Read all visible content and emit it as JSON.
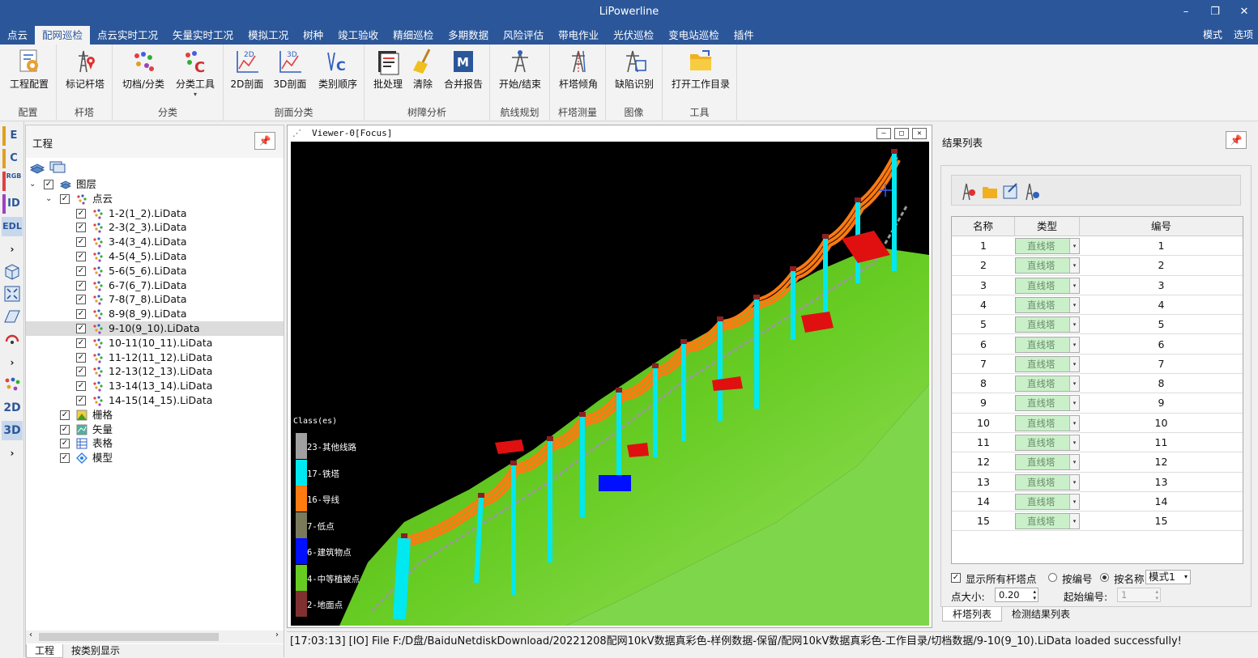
{
  "app": {
    "title": "LiPowerline"
  },
  "window": {
    "min": "–",
    "restore": "❐",
    "close": "✕"
  },
  "menu": {
    "items": [
      "点云",
      "配网巡检",
      "点云实时工况",
      "矢量实时工况",
      "模拟工况",
      "树种",
      "竣工验收",
      "精细巡检",
      "多期数据",
      "风险评估",
      "带电作业",
      "光伏巡检",
      "变电站巡检",
      "插件"
    ],
    "active_index": 1,
    "right": [
      "模式",
      "选项"
    ]
  },
  "ribbon": {
    "groups": [
      {
        "label": "配置",
        "buttons": [
          "工程配置"
        ]
      },
      {
        "label": "杆塔",
        "buttons": [
          "标记杆塔"
        ]
      },
      {
        "label": "分类",
        "buttons": [
          "切档/分类",
          "分类工具"
        ]
      },
      {
        "label": "剖面分类",
        "buttons": [
          "2D剖面",
          "3D剖面",
          "类别顺序"
        ]
      },
      {
        "label": "树障分析",
        "buttons": [
          "批处理",
          "清除",
          "合并报告"
        ]
      },
      {
        "label": "航线规划",
        "buttons": [
          "开始/结束"
        ]
      },
      {
        "label": "杆塔测量",
        "buttons": [
          "杆塔倾角"
        ]
      },
      {
        "label": "图像",
        "buttons": [
          "缺陷识别"
        ]
      },
      {
        "label": "工具",
        "buttons": [
          "打开工作目录"
        ]
      }
    ]
  },
  "left_toolbar": {
    "items": [
      "E",
      "C",
      "RGB",
      "ID",
      "EDL",
      "2D",
      "3D"
    ]
  },
  "project": {
    "title": "工程",
    "layers_label": "图层",
    "pointcloud_label": "点云",
    "files": [
      "1-2(1_2).LiData",
      "2-3(2_3).LiData",
      "3-4(3_4).LiData",
      "4-5(4_5).LiData",
      "5-6(5_6).LiData",
      "6-7(6_7).LiData",
      "7-8(7_8).LiData",
      "8-9(8_9).LiData",
      "9-10(9_10).LiData",
      "10-11(10_11).LiData",
      "11-12(11_12).LiData",
      "12-13(12_13).LiData",
      "13-14(13_14).LiData",
      "14-15(14_15).LiData"
    ],
    "selected_index": 8,
    "other_layers": [
      "栅格",
      "矢量",
      "表格",
      "模型"
    ],
    "tabs": [
      "工程",
      "按类别显示"
    ]
  },
  "viewer": {
    "title": "Viewer-0[Focus]",
    "legend_title": "Class(es)",
    "classes": [
      {
        "label": "23-其他线路",
        "color": "#a0a0a0"
      },
      {
        "label": "17-铁塔",
        "color": "#00e8f0"
      },
      {
        "label": "16-导线",
        "color": "#ff7a10"
      },
      {
        "label": "7-低点",
        "color": "#7a7a5a"
      },
      {
        "label": "6-建筑物点",
        "color": "#0010ff"
      },
      {
        "label": "4-中等植被点",
        "color": "#66cc22"
      },
      {
        "label": "2-地面点",
        "color": "#803030"
      }
    ]
  },
  "results": {
    "title": "结果列表",
    "headers": [
      "名称",
      "类型",
      "编号"
    ],
    "rows": [
      {
        "name": "1",
        "type": "直线塔",
        "id": "1"
      },
      {
        "name": "2",
        "type": "直线塔",
        "id": "2"
      },
      {
        "name": "3",
        "type": "直线塔",
        "id": "3"
      },
      {
        "name": "4",
        "type": "直线塔",
        "id": "4"
      },
      {
        "name": "5",
        "type": "直线塔",
        "id": "5"
      },
      {
        "name": "6",
        "type": "直线塔",
        "id": "6"
      },
      {
        "name": "7",
        "type": "直线塔",
        "id": "7"
      },
      {
        "name": "8",
        "type": "直线塔",
        "id": "8"
      },
      {
        "name": "9",
        "type": "直线塔",
        "id": "9"
      },
      {
        "name": "10",
        "type": "直线塔",
        "id": "10"
      },
      {
        "name": "11",
        "type": "直线塔",
        "id": "11"
      },
      {
        "name": "12",
        "type": "直线塔",
        "id": "12"
      },
      {
        "name": "13",
        "type": "直线塔",
        "id": "13"
      },
      {
        "name": "14",
        "type": "直线塔",
        "id": "14"
      },
      {
        "name": "15",
        "type": "直线塔",
        "id": "15"
      }
    ],
    "show_all_label": "显示所有杆塔点",
    "by_number_label": "按编号",
    "by_name_label": "按名称",
    "mode_value": "模式1",
    "point_size_label": "点大小:",
    "point_size_value": "0.20",
    "start_number_label": "起始编号:",
    "start_number_value": "1",
    "tabs": [
      "杆塔列表",
      "检测结果列表"
    ]
  },
  "status": {
    "text": "[17:03:13] [IO]    File F:/D盘/BaiduNetdiskDownload/20221208配网10kV数据真彩色-样例数据-保留/配网10kV数据真彩色-工作目录/切档数据/9-10(9_10).LiData loaded successfully!"
  }
}
